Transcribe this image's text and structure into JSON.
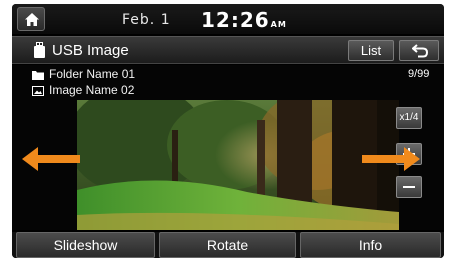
{
  "statusbar": {
    "date": "Feb.  1",
    "time": "12:26",
    "ampm": "AM"
  },
  "titlebar": {
    "title": "USB Image",
    "list_label": "List"
  },
  "fileinfo": {
    "folder_name": "Folder Name 01",
    "image_name": "Image Name 02",
    "counter": "9/99"
  },
  "controls": {
    "zoom_label": "x1/4"
  },
  "bottombar": {
    "slideshow_label": "Slideshow",
    "rotate_label": "Rotate",
    "info_label": "Info"
  },
  "icons": {
    "home": "home-icon",
    "usb": "usb-icon",
    "back": "back-arrow-icon",
    "folder": "folder-icon",
    "image": "image-icon",
    "left": "left-arrow-icon",
    "right": "right-arrow-icon"
  },
  "colors": {
    "arrow": "#f08a1c",
    "screen_bg": "#000000"
  }
}
